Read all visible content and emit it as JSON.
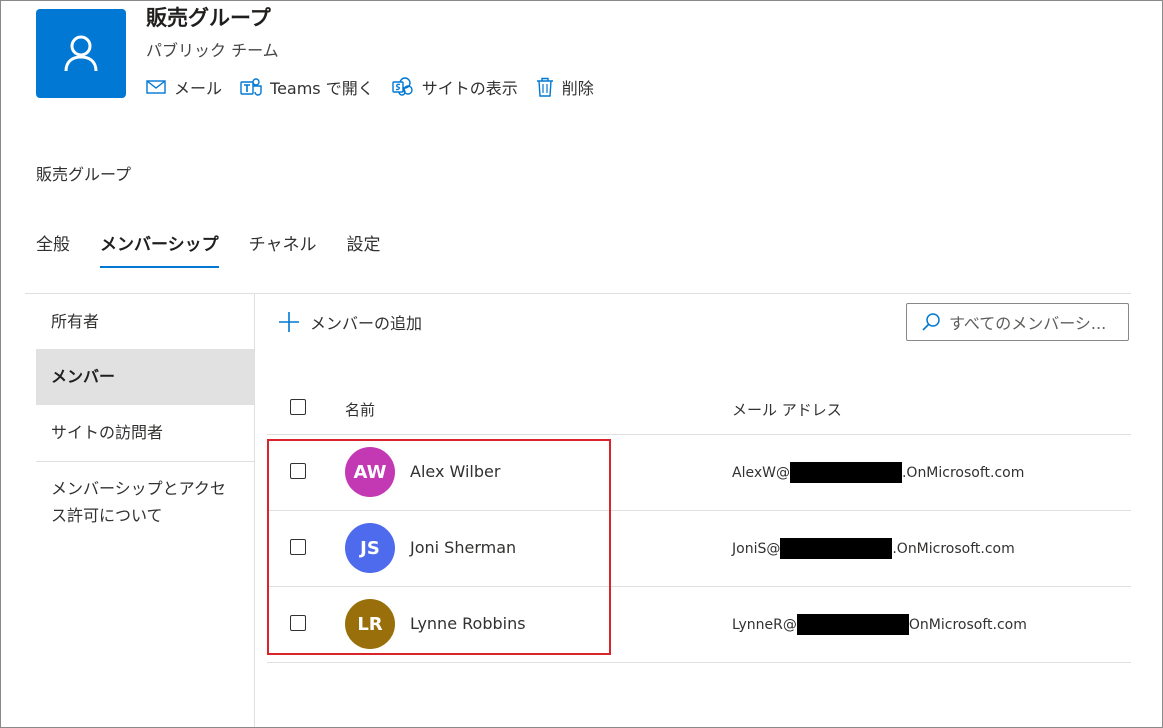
{
  "group": {
    "title": "販売グループ",
    "subtitle": "パブリック チーム",
    "actions": [
      {
        "label": "メール",
        "icon": "mail-icon"
      },
      {
        "label": "Teams で開く",
        "icon": "teams-icon"
      },
      {
        "label": "サイトの表示",
        "icon": "sharepoint-icon"
      },
      {
        "label": "削除",
        "icon": "trash-icon"
      }
    ]
  },
  "breadcrumb": "販売グループ",
  "tabs": [
    {
      "label": "全般",
      "active": false
    },
    {
      "label": "メンバーシップ",
      "active": true
    },
    {
      "label": "チャネル",
      "active": false
    },
    {
      "label": "設定",
      "active": false
    }
  ],
  "sidebar": {
    "items": [
      {
        "label": "所有者",
        "selected": false
      },
      {
        "label": "メンバー",
        "selected": true
      },
      {
        "label": "サイトの訪問者",
        "selected": false
      },
      {
        "label": "メンバーシップとアクセス許可について",
        "selected": false
      }
    ]
  },
  "toolbar": {
    "add_member_label": "メンバーの追加",
    "search_placeholder": "すべてのメンバーシ..."
  },
  "table": {
    "columns": [
      "名前",
      "メール アドレス"
    ],
    "rows": [
      {
        "initials": "AW",
        "name": "Alex Wilber",
        "email_prefix": "AlexW@",
        "email_suffix": ".OnMicrosoft.com",
        "avatar_color": "#c239b3"
      },
      {
        "initials": "JS",
        "name": "Joni Sherman",
        "email_prefix": "JoniS@",
        "email_suffix": ".OnMicrosoft.com",
        "avatar_color": "#4f6bed"
      },
      {
        "initials": "LR",
        "name": "Lynne Robbins",
        "email_prefix": "LynneR@",
        "email_suffix": "OnMicrosoft.com",
        "avatar_color": "#986f0b"
      }
    ]
  },
  "colors": {
    "accent": "#0078d4",
    "highlight": "#d9242b"
  }
}
